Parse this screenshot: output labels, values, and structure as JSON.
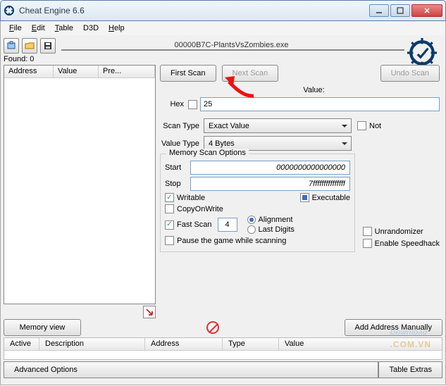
{
  "window": {
    "title": "Cheat Engine 6.6"
  },
  "menu": {
    "file": "File",
    "edit": "Edit",
    "table": "Table",
    "d3d": "D3D",
    "help": "Help"
  },
  "process": {
    "label": "00000B7C-PlantsVsZombies.exe"
  },
  "settings_label": "Settings",
  "found": "Found: 0",
  "columns": {
    "address": "Address",
    "value": "Value",
    "previous": "Pre..."
  },
  "scan": {
    "first": "First Scan",
    "next": "Next Scan",
    "undo": "Undo Scan",
    "value_label": "Value:",
    "hex_label": "Hex",
    "value_input": "25",
    "scan_type_label": "Scan Type",
    "scan_type": "Exact Value",
    "not_label": "Not",
    "value_type_label": "Value Type",
    "value_type": "4 Bytes"
  },
  "memory": {
    "group_title": "Memory Scan Options",
    "start_label": "Start",
    "start_value": "0000000000000000",
    "stop_label": "Stop",
    "stop_value": "7fffffffffffffff",
    "writable": "Writable",
    "executable": "Executable",
    "copyonwrite": "CopyOnWrite",
    "fastscan": "Fast Scan",
    "fastscan_value": "4",
    "alignment": "Alignment",
    "lastdigits": "Last Digits",
    "pause": "Pause the game while scanning"
  },
  "right_opts": {
    "unrandomizer": "Unrandomizer",
    "speedhack": "Enable Speedhack"
  },
  "bottom": {
    "memory_view": "Memory view",
    "add_manual": "Add Address Manually"
  },
  "table": {
    "active": "Active",
    "description": "Description",
    "address": "Address",
    "type": "Type",
    "value": "Value"
  },
  "footer": {
    "advanced": "Advanced Options",
    "extras": "Table Extras"
  },
  "watermark": {
    "main": "Download",
    "sub": ".COM.VN"
  }
}
